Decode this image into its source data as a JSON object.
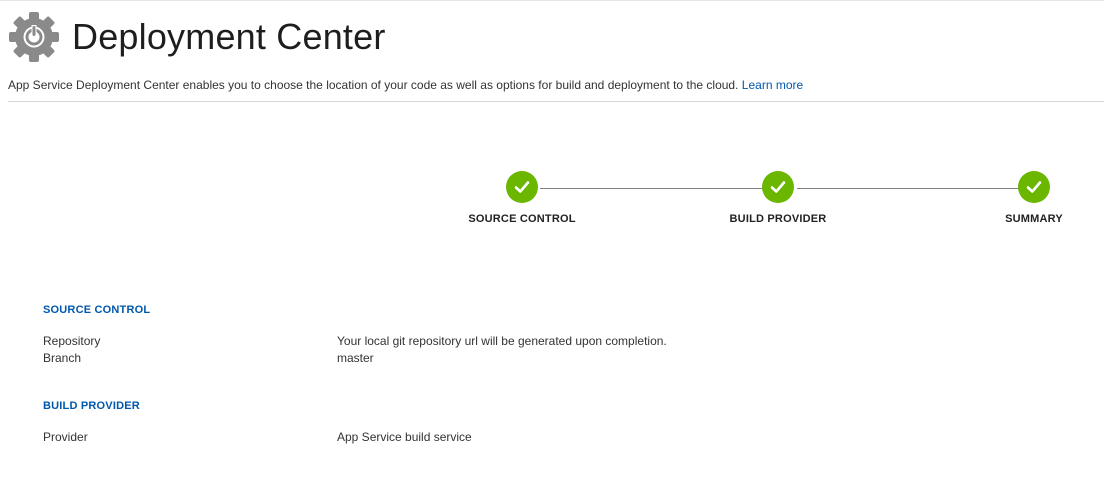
{
  "header": {
    "icon": "gear-power-icon",
    "title": "Deployment Center",
    "description": "App Service Deployment Center enables you to choose the location of your code as well as options for build and deployment to the cloud.",
    "learn_more": "Learn more"
  },
  "steps": [
    {
      "label": "SOURCE CONTROL",
      "status": "complete",
      "icon": "checkmark-icon"
    },
    {
      "label": "BUILD PROVIDER",
      "status": "complete",
      "icon": "checkmark-icon"
    },
    {
      "label": "SUMMARY",
      "status": "complete",
      "icon": "checkmark-icon"
    }
  ],
  "summary": {
    "source_control": {
      "heading": "SOURCE CONTROL",
      "rows": [
        {
          "label": "Repository",
          "value": "Your local git repository url will be generated upon completion."
        },
        {
          "label": "Branch",
          "value": "master"
        }
      ]
    },
    "build_provider": {
      "heading": "BUILD PROVIDER",
      "rows": [
        {
          "label": "Provider",
          "value": "App Service build service"
        }
      ]
    }
  },
  "colors": {
    "accent": "#0058ad",
    "success": "#6bb700",
    "connector": "#808080",
    "icon_gray": "#8a8a8a"
  }
}
